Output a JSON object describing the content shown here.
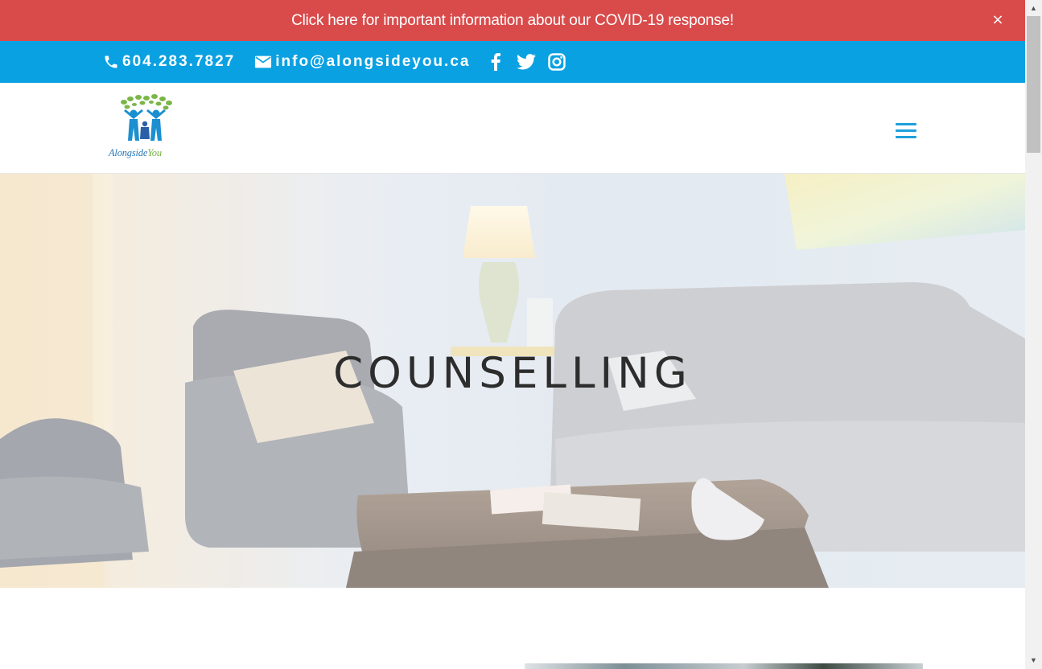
{
  "covid_banner": {
    "text": "Click here for important information about our COVID-19 response!",
    "close_label": "×"
  },
  "top_bar": {
    "phone": "604.283.7827",
    "email": "info@alongsideyou.ca",
    "social": [
      "facebook-icon",
      "twitter-icon",
      "instagram-icon"
    ]
  },
  "header": {
    "logo_text_main": "Alongside",
    "logo_text_accent": "You"
  },
  "hero": {
    "title": "COUNSELLING"
  },
  "colors": {
    "banner": "#d94b4b",
    "top_bar": "#0aa1e2",
    "accent": "#1fa0dc",
    "logo_green": "#74b243"
  },
  "scrollbar": {
    "up": "▲",
    "down": "▼"
  }
}
